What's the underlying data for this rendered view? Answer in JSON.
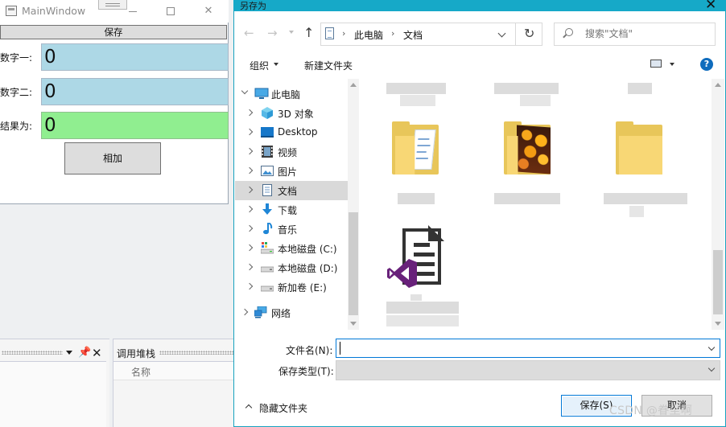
{
  "main_window": {
    "title": "MainWindow",
    "save_label": "保存",
    "label_number1": "数字一:",
    "label_number2": "数字二:",
    "label_result": "结果为:",
    "number1_value": "0",
    "number2_value": "0",
    "result_value": "0",
    "add_label": "相加",
    "colors": {
      "number_field": "#add8e6",
      "result_field": "#90ee90"
    }
  },
  "ide": {
    "callstack_title": "调用堆栈",
    "callstack_column_name": "名称"
  },
  "dialog": {
    "title": "另存为",
    "accent": "#16a9c8",
    "breadcrumb": [
      "此电脑",
      "文档"
    ],
    "search_placeholder": "搜索\"文档\"",
    "toolbar": {
      "organize": "组织",
      "new_folder": "新建文件夹"
    },
    "nav_tree": [
      {
        "label": "此电脑",
        "icon": "computer-icon",
        "selected": false,
        "expanded": true
      },
      {
        "label": "3D 对象",
        "icon": "cube-3d-icon",
        "selected": false
      },
      {
        "label": "Desktop",
        "icon": "desktop-icon",
        "selected": false
      },
      {
        "label": "视频",
        "icon": "video-icon",
        "selected": false
      },
      {
        "label": "图片",
        "icon": "picture-icon",
        "selected": false
      },
      {
        "label": "文档",
        "icon": "document-icon",
        "selected": true
      },
      {
        "label": "下载",
        "icon": "download-icon",
        "selected": false
      },
      {
        "label": "音乐",
        "icon": "music-icon",
        "selected": false
      },
      {
        "label": "本地磁盘 (C:)",
        "icon": "drive-c-icon",
        "selected": false
      },
      {
        "label": "本地磁盘 (D:)",
        "icon": "drive-icon",
        "selected": false
      },
      {
        "label": "新加卷 (E:)",
        "icon": "drive-icon",
        "selected": false
      },
      {
        "label": "网络",
        "icon": "network-icon",
        "selected": false
      }
    ],
    "filename_label": "文件名(N):",
    "filename_value": "",
    "filetype_label": "保存类型(T):",
    "filetype_value": "",
    "hide_folders": "隐藏文件夹",
    "save_button": "保存(S)",
    "cancel_button": "取消"
  },
  "watermark": "CSDN @眷尘啊"
}
